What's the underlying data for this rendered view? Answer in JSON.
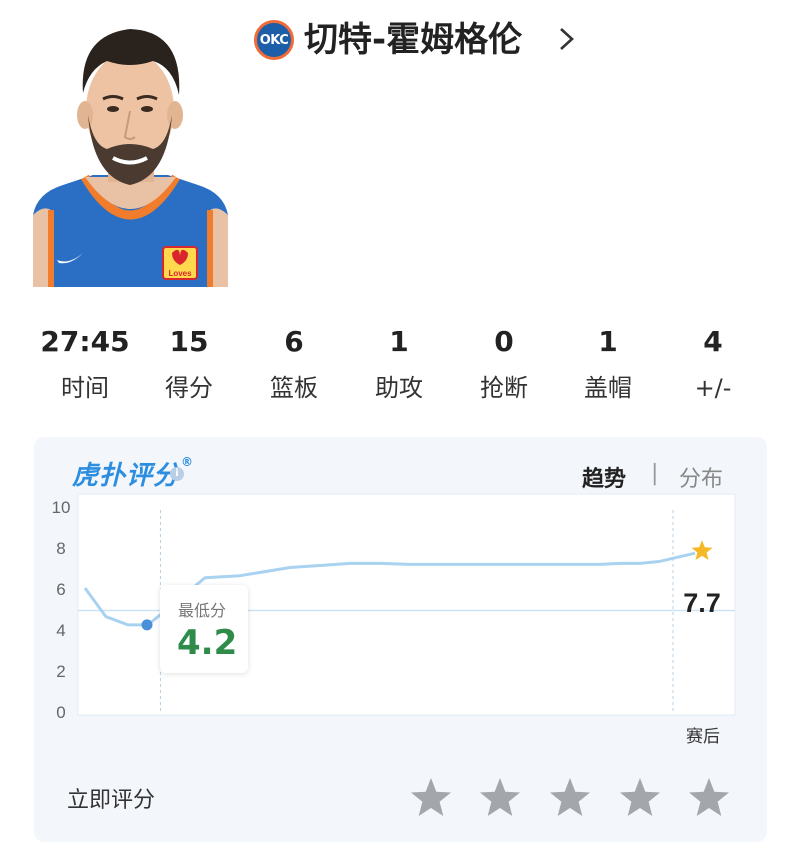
{
  "player": {
    "name": "切特-霍姆格伦",
    "team_abbr": "OKC",
    "jersey_sponsor": "Loves"
  },
  "stats": [
    {
      "value": "27:45",
      "label": "时间"
    },
    {
      "value": "15",
      "label": "得分"
    },
    {
      "value": "6",
      "label": "篮板"
    },
    {
      "value": "1",
      "label": "助攻"
    },
    {
      "value": "0",
      "label": "抢断"
    },
    {
      "value": "1",
      "label": "盖帽"
    },
    {
      "value": "4",
      "label": "+/-"
    }
  ],
  "rating": {
    "logo_text": "虎扑评分",
    "info_icon": "i",
    "tabs": {
      "active": "趋势",
      "separator": "|",
      "inactive": "分布"
    },
    "rate_now_label": "立即评分",
    "stars_count": 5
  },
  "chart_data": {
    "type": "line",
    "ylim": [
      0,
      10
    ],
    "yticks": [
      "10",
      "8",
      "6",
      "4",
      "2",
      "0"
    ],
    "xlabel_end": "赛后",
    "series": [
      {
        "values": [
          6.0,
          4.6,
          4.2,
          4.2,
          6.5,
          6.6,
          6.8,
          7.0,
          7.1,
          7.2,
          7.2,
          7.15,
          7.15,
          7.15,
          7.15,
          7.15,
          7.15,
          7.2,
          7.2,
          7.3,
          7.7
        ]
      }
    ],
    "average_line": 4.9,
    "min": {
      "label": "最低分",
      "value": "4.2"
    },
    "final": {
      "value": "7.7"
    },
    "colors": {
      "line": "#a9d2f1",
      "marker": "#4a90d9",
      "star": "#f5b928",
      "value_green": "#2e8b4a"
    }
  }
}
